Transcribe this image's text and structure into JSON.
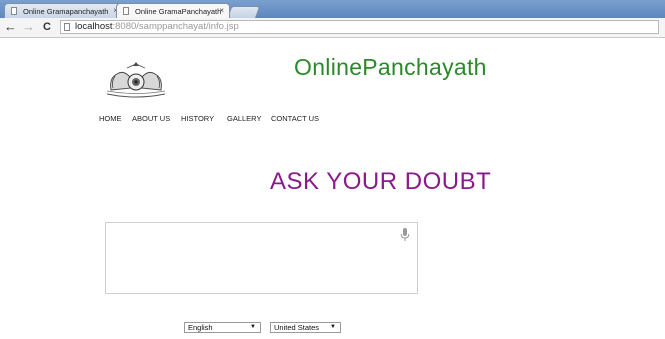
{
  "browser": {
    "tabs": [
      {
        "title": "Online Gramapanchayath",
        "close": "×"
      },
      {
        "title": "Online GramaPanchayath",
        "close": "×"
      }
    ],
    "nav": {
      "back": "←",
      "forward": "→",
      "reload": "C"
    },
    "address": {
      "host": "localhost",
      "path": ":8080/samppanchayat/info.jsp"
    }
  },
  "site": {
    "title": "OnlinePanchayath",
    "menu": [
      "HOME",
      "ABOUT US",
      "HISTORY",
      "GALLERY",
      "CONTACT US"
    ]
  },
  "main": {
    "heading": "ASK YOUR DOUBT",
    "doubt_value": "",
    "language": "English",
    "region": "United States",
    "dropdown_arrow": "▼"
  },
  "icons": {
    "logo": "emblem-logo",
    "mic": "microphone-icon",
    "page": "page-icon"
  },
  "colors": {
    "title": "#2a8a2a",
    "heading": "#8a1a8a",
    "tabstrip": "#6f95c8"
  }
}
